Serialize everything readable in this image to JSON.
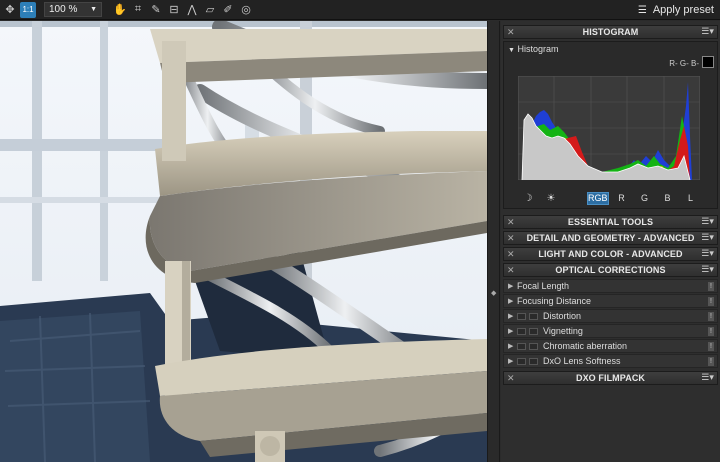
{
  "toolbar": {
    "zoom_value": "100 %",
    "apply_preset_label": "Apply preset"
  },
  "histogram_panel": {
    "title": "HISTOGRAM",
    "subsection": "Histogram",
    "readout": "R- G- B-",
    "channels": [
      "RGB",
      "R",
      "G",
      "B",
      "L"
    ],
    "selected_channel": "RGB"
  },
  "sections": {
    "essential_tools": "ESSENTIAL TOOLS",
    "detail_geometry": "DETAIL AND GEOMETRY - ADVANCED",
    "light_color": "LIGHT AND COLOR - ADVANCED",
    "optical_corrections": "OPTICAL CORRECTIONS",
    "dxo_filmpack": "DXO FILMPACK"
  },
  "optical_items": [
    "Focal Length",
    "Focusing Distance",
    "Distortion",
    "Vignetting",
    "Chromatic aberration",
    "DxO Lens Softness"
  ],
  "colors": {
    "accent": "#2d7fb8"
  }
}
